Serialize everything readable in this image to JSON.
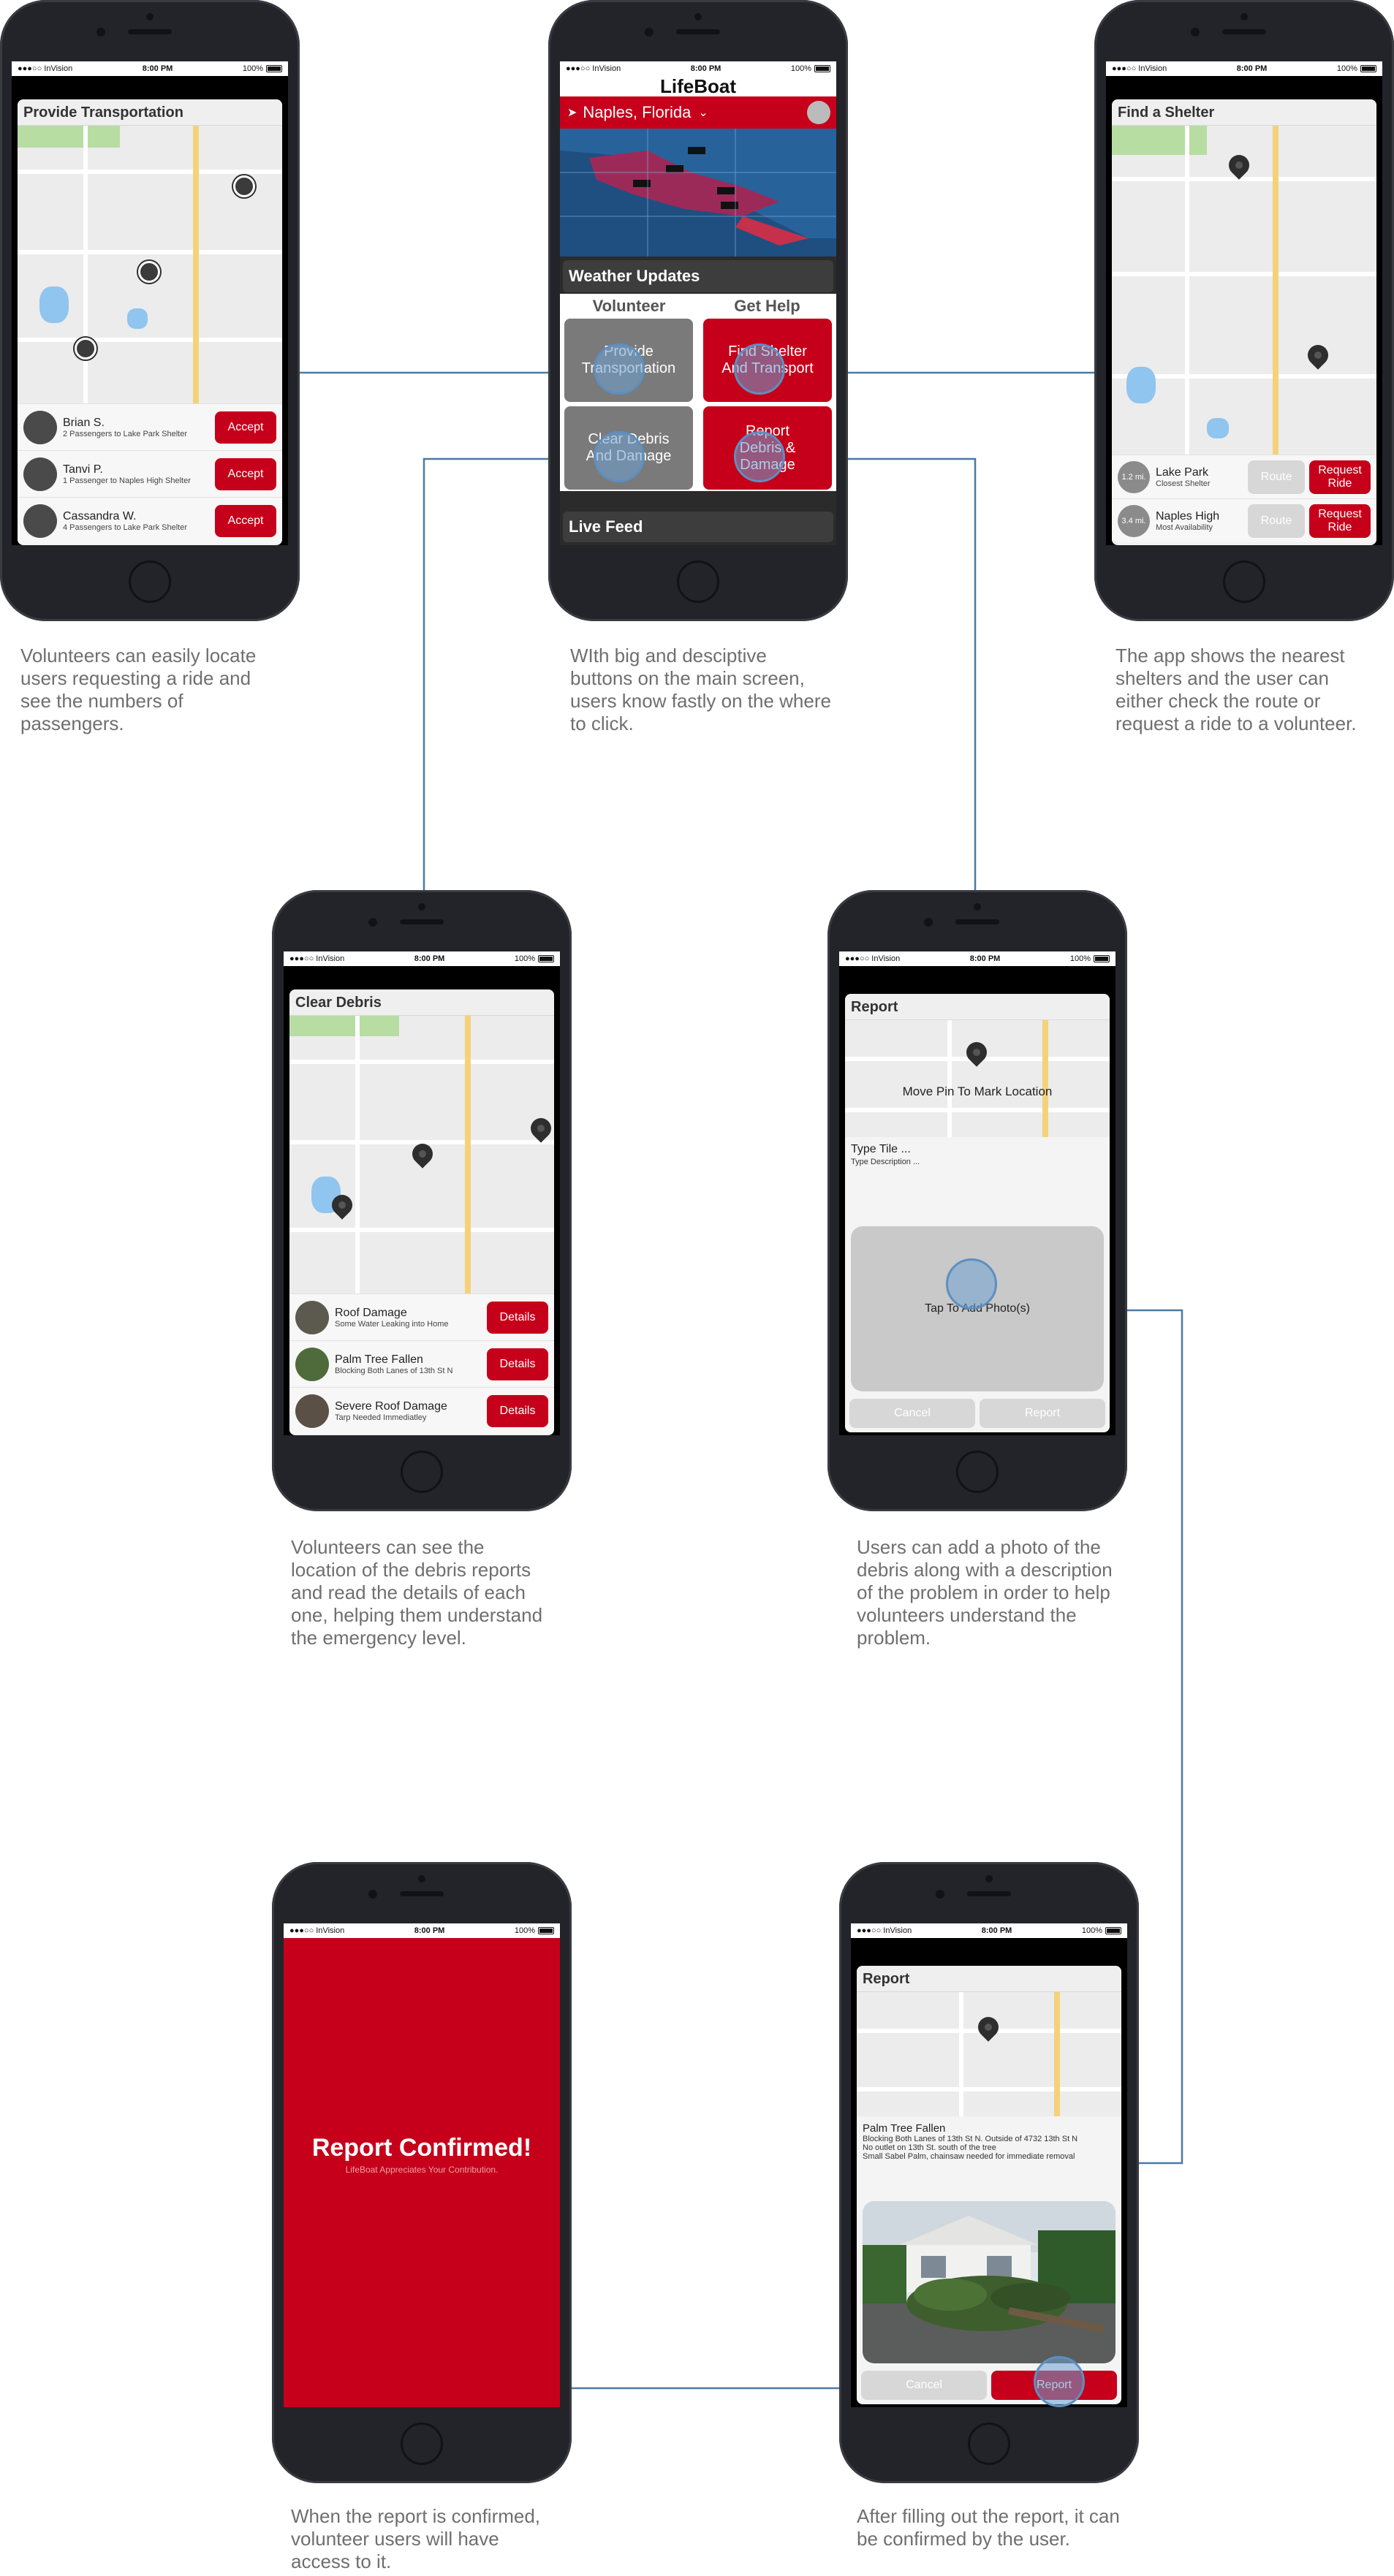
{
  "status_bar": {
    "carrier": "●●●○○ InVision",
    "time": "8:00 PM",
    "battery": "100%"
  },
  "colors": {
    "accent": "#c6001a",
    "connector": "#4a7aa3",
    "caption": "#6f6f6f"
  },
  "transport": {
    "title": "Provide Transportation",
    "rows": [
      {
        "name": "Brian S.",
        "sub": "2 Passengers to Lake Park Shelter",
        "button": "Accept"
      },
      {
        "name": "Tanvi P.",
        "sub": "1 Passenger to Naples High Shelter",
        "button": "Accept"
      },
      {
        "name": "Cassandra W.",
        "sub": "4 Passengers to Lake Park Shelter",
        "button": "Accept"
      }
    ]
  },
  "home": {
    "app_title": "LifeBoat",
    "location": "Naples, Florida",
    "weather_label": "Weather Updates",
    "volunteer_label": "Volunteer",
    "help_label": "Get Help",
    "provide_button": "Provide Transportation",
    "shelter_button": "Find Shelter And Transport",
    "clear_button": "Clear Debris And Damage",
    "report_button": "Report Debris & Damage",
    "live_feed_label": "Live Feed"
  },
  "shelter": {
    "title": "Find a Shelter",
    "rows": [
      {
        "distance": "1.2 mi.",
        "name": "Lake Park",
        "sub": "Closest Shelter",
        "route": "Route",
        "request": "Request Ride"
      },
      {
        "distance": "3.4 mi.",
        "name": "Naples High",
        "sub": "Most Availability",
        "route": "Route",
        "request": "Request Ride"
      }
    ]
  },
  "debris": {
    "title": "Clear Debris",
    "rows": [
      {
        "name": "Roof Damage",
        "sub": "Some Water Leaking into Home",
        "button": "Details"
      },
      {
        "name": "Palm Tree Fallen",
        "sub": "Blocking Both Lanes of 13th St N",
        "button": "Details"
      },
      {
        "name": "Severe Roof Damage",
        "sub": "Tarp Needed Immediatley",
        "button": "Details"
      }
    ]
  },
  "report_empty": {
    "title": "Report",
    "map_hint": "Move Pin To Mark Location",
    "title_placeholder": "Type Tile ...",
    "description_placeholder": "Type Description ...",
    "photo_label": "Tap To Add Photo(s)",
    "cancel": "Cancel",
    "report": "Report"
  },
  "report_filled": {
    "title": "Report",
    "item_title": "Palm Tree Fallen",
    "line1": "Blocking Both Lanes of 13th St N. Outside of 4732 13th St N",
    "line2": "No outlet on 13th St. south of the tree",
    "line3": "Small Sabel Palm, chainsaw needed for immediate removal",
    "cancel": "Cancel",
    "report": "Report"
  },
  "confirmed": {
    "title": "Report Confirmed!",
    "subtitle": "LifeBoat Appreciates Your Contribution."
  },
  "captions": {
    "c1": "Volunteers can easily locate users requesting a ride and see the numbers of passengers.",
    "c2": "WIth big and desciptive buttons on the main screen, users know fastly on the where to click.",
    "c3": "The app shows the nearest shelters and the user can either check the route or request a ride to a volunteer.",
    "c4": "Volunteers can see the location of the debris reports and read the details of each one, helping them understand the emergency level.",
    "c5": "Users can add a photo of the debris along with a description of the problem in order to help volunteers understand the problem.",
    "c6": "When the report is confirmed, volunteer users will have access to it.",
    "c7": "After filling out the report, it can be confirmed by the user."
  }
}
